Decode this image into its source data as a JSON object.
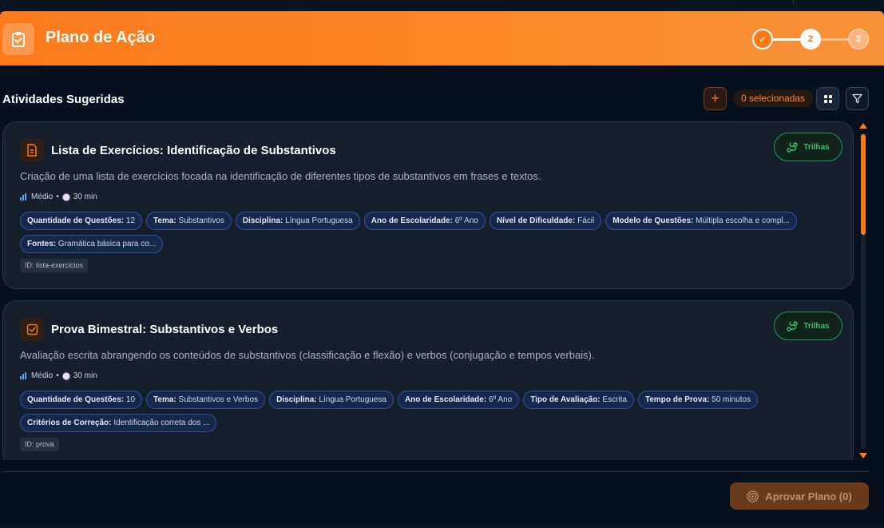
{
  "header": {
    "title": "Plano de Ação",
    "steps": [
      {
        "label": "✓",
        "state": "done"
      },
      {
        "label": "2",
        "state": "current"
      },
      {
        "label": "3",
        "state": "pending"
      }
    ]
  },
  "toolbar": {
    "section_title": "Atividades Sugeridas",
    "add_label": "+",
    "selected_label": "0 selecionadas"
  },
  "cards": [
    {
      "title": "Lista de Exercícios: Identificação de Substantivos",
      "description": "Criação de uma lista de exercícios focada na identificação de diferentes tipos de substantivos em frases e textos.",
      "difficulty": "Médio",
      "separator": "•",
      "duration": "30 min",
      "trilhas_label": "Trilhas",
      "id_label": "ID: lista-exercicios",
      "tags": [
        {
          "key": "Quantidade de Questões:",
          "value": "12"
        },
        {
          "key": "Tema:",
          "value": "Substantivos"
        },
        {
          "key": "Disciplina:",
          "value": "Língua Portuguesa"
        },
        {
          "key": "Ano de Escolaridade:",
          "value": "6º Ano"
        },
        {
          "key": "Nível de Dificuldade:",
          "value": "Fácil"
        },
        {
          "key": "Modelo de Questões:",
          "value": "Múltipla escolha e compl..."
        },
        {
          "key": "Fontes:",
          "value": "Gramática básica para co..."
        }
      ]
    },
    {
      "title": "Prova Bimestral: Substantivos e Verbos",
      "description": "Avaliação escrita abrangendo os conteúdos de substantivos (classificação e flexão) e verbos (conjugação e tempos verbais).",
      "difficulty": "Médio",
      "separator": "•",
      "duration": "30 min",
      "trilhas_label": "Trilhas",
      "id_label": "ID: prova",
      "tags": [
        {
          "key": "Quantidade de Questões:",
          "value": "10"
        },
        {
          "key": "Tema:",
          "value": "Substantivos e Verbos"
        },
        {
          "key": "Disciplina:",
          "value": "Língua Portuguesa"
        },
        {
          "key": "Ano de Escolaridade:",
          "value": "6º Ano"
        },
        {
          "key": "Tipo de Avaliação:",
          "value": "Escrita"
        },
        {
          "key": "Tempo de Prova:",
          "value": "50 minutos"
        },
        {
          "key": "Critérios de Correção:",
          "value": "Identificação correta dos ..."
        }
      ]
    }
  ],
  "footer": {
    "approve_label": "Aprovar Plano (0)"
  },
  "colors": {
    "accent": "#fb7a1a",
    "tag_border": "#2c4fa8",
    "trilhas": "#2ec46c"
  }
}
